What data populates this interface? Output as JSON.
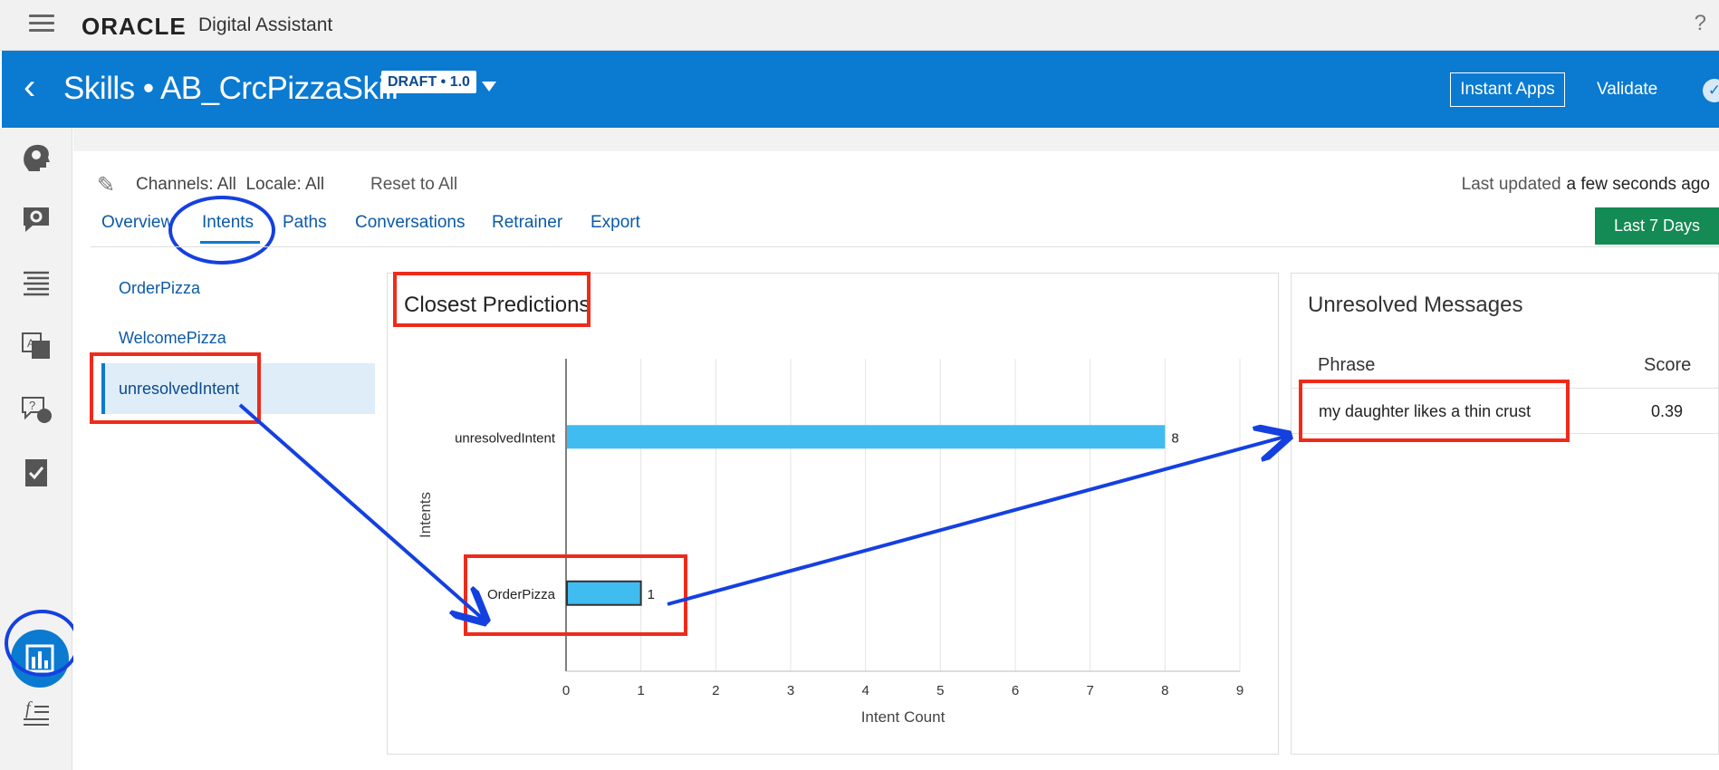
{
  "topbar": {
    "brand": "ORACLE",
    "product": "Digital Assistant",
    "help_icon": "help-icon"
  },
  "header": {
    "title": "Skills • AB_CrcPizzaSkill",
    "badge": "DRAFT • 1.0",
    "instant_apps": "Instant Apps",
    "validate": "Validate"
  },
  "filters": {
    "channels": "Channels: All  Locale: All",
    "reset": "Reset to All",
    "last_updated_label": "Last updated",
    "last_updated_value": "a few seconds ago"
  },
  "tabs": {
    "overview": "Overview",
    "intents": "Intents",
    "paths": "Paths",
    "conversations": "Conversations",
    "retrainer": "Retrainer",
    "export": "Export",
    "date_range": "Last 7 Days",
    "active": "Intents"
  },
  "intents": {
    "items": [
      {
        "label": "OrderPizza"
      },
      {
        "label": "WelcomePizza"
      },
      {
        "label": "unresolvedIntent",
        "selected": true
      }
    ]
  },
  "chart_panel": {
    "title": "Closest Predictions"
  },
  "chart_data": {
    "type": "bar",
    "orientation": "horizontal",
    "categories": [
      "unresolvedIntent",
      "OrderPizza"
    ],
    "values": [
      8,
      1
    ],
    "title": "Closest Predictions",
    "xlabel": "Intent Count",
    "ylabel": "Intents",
    "xlim": [
      0,
      9
    ],
    "xticks": [
      "0",
      "1",
      "2",
      "3",
      "4",
      "5",
      "6",
      "7",
      "8",
      "9"
    ],
    "grid": true,
    "color": "#40bcf0"
  },
  "unresolved": {
    "title": "Unresolved Messages",
    "columns": [
      "Phrase",
      "Score"
    ],
    "rows": [
      {
        "phrase": "my daughter likes a thin crust",
        "score": "0.39"
      }
    ]
  },
  "colors": {
    "header_blue": "#0b7ad1",
    "annotation_red": "#ee2b1b",
    "annotation_blue": "#1540e0",
    "date_button_green": "#148a55"
  },
  "rail_icons": [
    "bot-head-icon",
    "gear-chat-icon",
    "align-text-icon",
    "translate-icon",
    "question-chat-icon",
    "clipboard-check-icon",
    "analytics-icon",
    "function-icon"
  ]
}
